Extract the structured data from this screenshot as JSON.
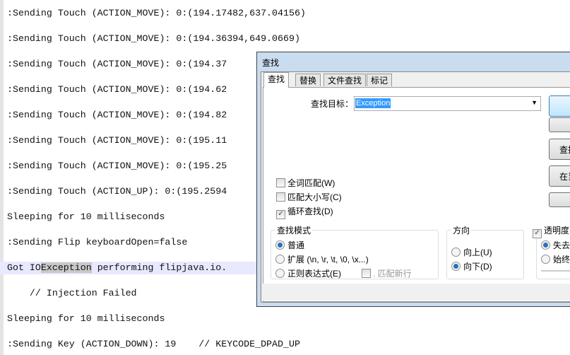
{
  "editor": {
    "lines": [
      ":Sending Touch (ACTION_MOVE): 0:(194.17482,637.04156)",
      ":Sending Touch (ACTION_MOVE): 0:(194.36394,649.0669)",
      ":Sending Touch (ACTION_MOVE): 0:(194.37",
      ":Sending Touch (ACTION_MOVE): 0:(194.62",
      ":Sending Touch (ACTION_MOVE): 0:(194.82",
      ":Sending Touch (ACTION_MOVE): 0:(195.11",
      ":Sending Touch (ACTION_MOVE): 0:(195.25",
      ":Sending Touch (ACTION_UP): 0:(195.2594",
      "Sleeping for 10 milliseconds",
      ":Sending Flip keyboardOpen=false",
      "",
      "    // Injection Failed",
      "Sleeping for 10 milliseconds",
      ":Sending Key (ACTION_DOWN): 19    // KEYCODE_DPAD_UP"
    ],
    "current_line": {
      "before": "Got IO",
      "match": "Exception",
      "after": " performing flipjava.io."
    }
  },
  "dialog": {
    "title": "查找",
    "tabs": [
      "查找",
      "替换",
      "文件查找",
      "标记"
    ],
    "active_tab": "查找",
    "find_label": "查找目标：",
    "find_value": "Exception",
    "buttons": [
      "",
      "",
      "查找",
      "在当",
      ""
    ],
    "checkboxes": [
      {
        "label": "全词匹配(W)",
        "checked": false
      },
      {
        "label": "匹配大小写(C)",
        "checked": false
      },
      {
        "label": "循环查找(D)",
        "checked": true
      }
    ],
    "search_mode": {
      "title": "查找模式",
      "options": [
        "普通",
        "扩展 (\\n, \\r, \\t, \\0, \\x...)",
        "正则表达式(E)"
      ],
      "selected": "普通",
      "dot_newline": ". 匹配新行"
    },
    "direction": {
      "title": "方向",
      "options": [
        "向上(U)",
        "向下(D)"
      ],
      "selected": "向下(D)"
    },
    "transparency": {
      "label": "透明度",
      "checked": true,
      "options": [
        "失去",
        "始终"
      ],
      "selected": "失去"
    }
  }
}
